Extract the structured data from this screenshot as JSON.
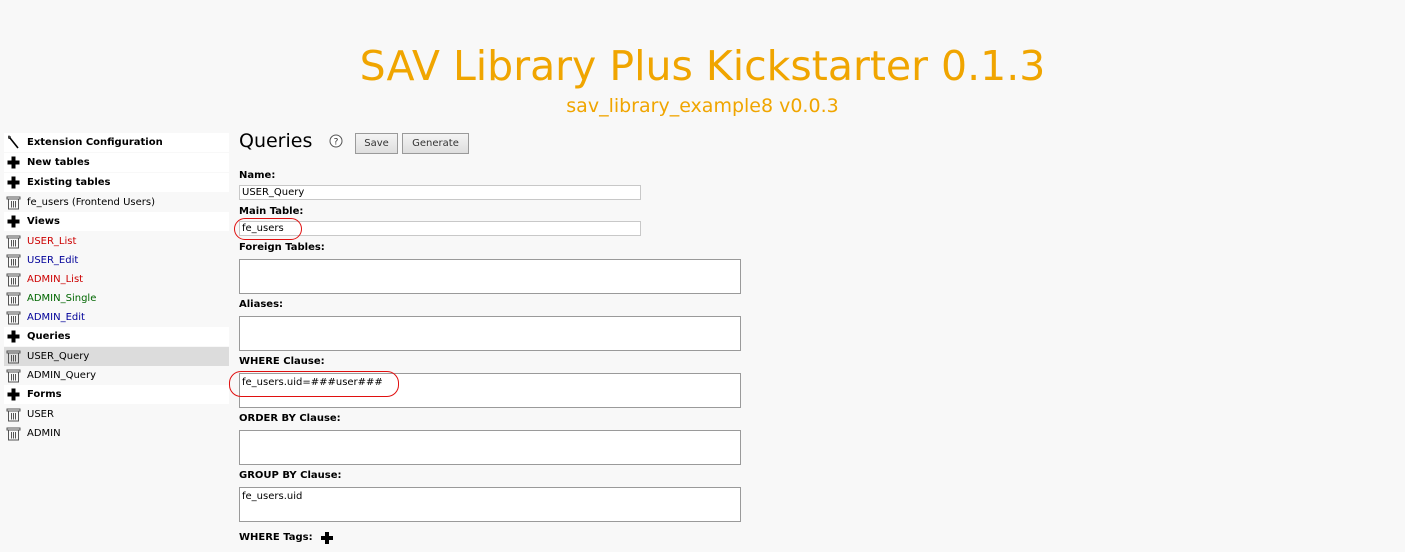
{
  "header": {
    "title": "SAV Library Plus Kickstarter 0.1.3",
    "subtitle": "sav_library_example8 v0.0.3"
  },
  "sidebar": {
    "items": [
      {
        "label": "Extension Configuration",
        "icon": "wand-icon",
        "type": "header"
      },
      {
        "label": "New tables",
        "icon": "plus-icon",
        "type": "header"
      },
      {
        "label": "Existing tables",
        "icon": "plus-icon",
        "type": "header"
      },
      {
        "label": "fe_users (Frontend Users)",
        "icon": "trash-icon",
        "type": "item"
      },
      {
        "label": "Views",
        "icon": "plus-icon",
        "type": "header"
      },
      {
        "label": "USER_List",
        "icon": "trash-icon",
        "type": "item",
        "color": "#cc0000"
      },
      {
        "label": "USER_Edit",
        "icon": "trash-icon",
        "type": "item",
        "color": "#000099"
      },
      {
        "label": "ADMIN_List",
        "icon": "trash-icon",
        "type": "item",
        "color": "#cc0000"
      },
      {
        "label": "ADMIN_Single",
        "icon": "trash-icon",
        "type": "item",
        "color": "#006600"
      },
      {
        "label": "ADMIN_Edit",
        "icon": "trash-icon",
        "type": "item",
        "color": "#000099"
      },
      {
        "label": "Queries",
        "icon": "plus-icon",
        "type": "header"
      },
      {
        "label": "USER_Query",
        "icon": "trash-icon",
        "type": "item",
        "selected": true
      },
      {
        "label": "ADMIN_Query",
        "icon": "trash-icon",
        "type": "item"
      },
      {
        "label": "Forms",
        "icon": "plus-icon",
        "type": "header"
      },
      {
        "label": "USER",
        "icon": "trash-icon",
        "type": "item"
      },
      {
        "label": "ADMIN",
        "icon": "trash-icon",
        "type": "item"
      }
    ]
  },
  "main": {
    "heading": "Queries",
    "help_icon": "help-icon",
    "buttons": {
      "save": "Save",
      "generate": "Generate"
    },
    "fields": {
      "name": {
        "label": "Name:",
        "value": "USER_Query"
      },
      "main_table": {
        "label": "Main Table:",
        "value": "fe_users"
      },
      "foreign_tables": {
        "label": "Foreign Tables:",
        "value": ""
      },
      "aliases": {
        "label": "Aliases:",
        "value": ""
      },
      "where_clause": {
        "label": "WHERE Clause:",
        "value": "fe_users.uid=###user###"
      },
      "order_by": {
        "label": "ORDER BY Clause:",
        "value": ""
      },
      "group_by": {
        "label": "GROUP BY Clause:",
        "value": "fe_users.uid"
      },
      "where_tags": {
        "label": "WHERE Tags:"
      }
    }
  },
  "colors": {
    "accent": "#f0a500",
    "highlight": "#e01010",
    "selected_bg": "#dcdcdc"
  }
}
